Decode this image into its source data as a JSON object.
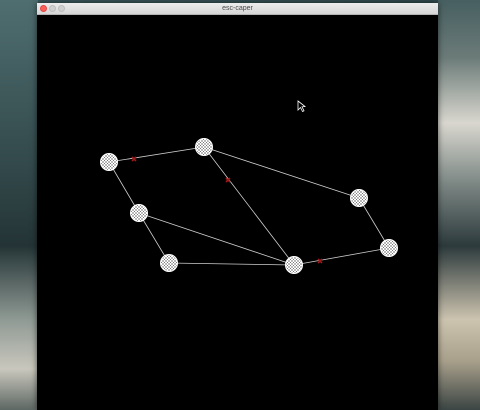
{
  "window": {
    "title": "esc-caper"
  },
  "graph": {
    "node_style": "wireframe-sphere",
    "node_color": "#ffffff",
    "edge_color": "#cfcfcf",
    "marker_color": "#a01818"
  }
}
